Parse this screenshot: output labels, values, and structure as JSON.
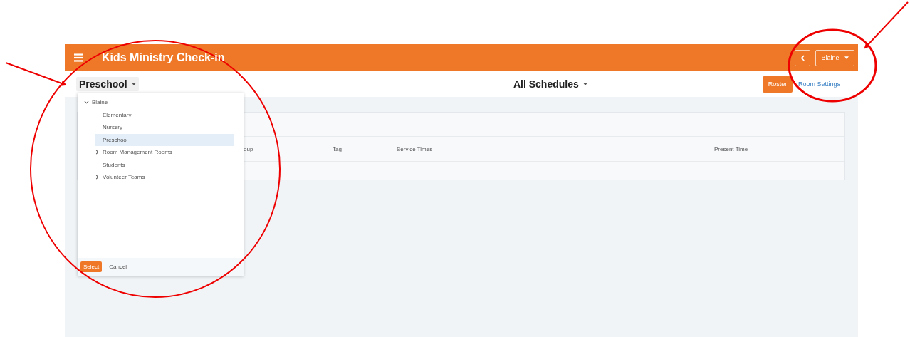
{
  "header": {
    "title": "Kids Ministry Check-in",
    "location_button": "Blaine"
  },
  "toolbar": {
    "room_picker": "Preschool",
    "schedule_picker": "All Schedules",
    "roster_button": "Roster",
    "settings_link": "Room Settings"
  },
  "table": {
    "columns": [
      "oup",
      "Tag",
      "Service Times",
      "Present Time"
    ]
  },
  "room_menu": {
    "tree": [
      {
        "label": "Blaine",
        "expanded": true,
        "selected": false,
        "children": [
          {
            "label": "Elementary",
            "selected": false
          },
          {
            "label": "Nursery",
            "selected": false
          },
          {
            "label": "Preschool",
            "selected": true
          },
          {
            "label": "Room Management Rooms",
            "expanded": false,
            "selected": false
          },
          {
            "label": "Students",
            "selected": false
          },
          {
            "label": "Volunteer Teams",
            "expanded": false,
            "selected": false
          }
        ]
      }
    ],
    "buttons": [
      {
        "label": "Select",
        "kind": "primary"
      },
      {
        "label": "Cancel",
        "kind": "plain"
      }
    ]
  }
}
